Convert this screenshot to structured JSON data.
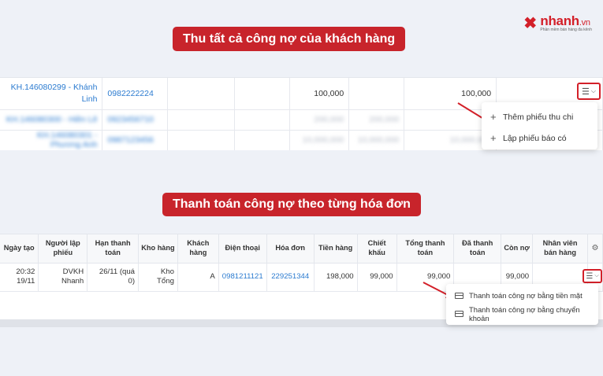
{
  "brand": {
    "name": "nhanh",
    "suffix": ".vn",
    "tagline": "Phần mềm bán hàng đa kênh"
  },
  "colors": {
    "accent": "#c8242b",
    "link": "#2b7bd0"
  },
  "banners": {
    "top": "Thu tất cả công nợ của khách hàng",
    "bottom": "Thanh toán công nợ theo từng hóa đơn"
  },
  "section1": {
    "row": {
      "customer": "KH.146080299 - Khánh Linh",
      "phone": "0982222224",
      "amount_a": "100,000",
      "amount_b": "100,000"
    },
    "blurred_rows": [
      {
        "customer": "KH.146080300 - Hiền Lê",
        "phone": "0923456710",
        "a": "200,000",
        "b": "200,000"
      },
      {
        "customer": "KH.146080301 - Phương Anh",
        "phone": "0987123456",
        "a": "10,000,000",
        "b": "10,000,000",
        "c": "10,000,000"
      }
    ],
    "menu": [
      "Thêm phiếu thu chi",
      "Lập phiếu báo có"
    ]
  },
  "section2": {
    "headers": [
      "Ngày tạo",
      "Người lập phiếu",
      "Hạn thanh toán",
      "Kho hàng",
      "Khách hàng",
      "Điện thoại",
      "Hóa đơn",
      "Tiền hàng",
      "Chiết khấu",
      "Tổng thanh toán",
      "Đã thanh toán",
      "Còn nợ",
      "Nhân viên bán hàng"
    ],
    "row": {
      "created": "20:32 19/11",
      "creator": "DVKH Nhanh",
      "due": "26/11 (quá 0)",
      "warehouse": "Kho Tổng",
      "customer": "A",
      "phone": "0981211121",
      "invoice": "229251344",
      "goods": "198,000",
      "discount": "99,000",
      "total": "99,000",
      "paid": "",
      "debt": "99,000",
      "staff": ""
    },
    "menu": [
      "Thanh toán công nợ bằng tiền mặt",
      "Thanh toán công nợ bằng chuyển khoản"
    ]
  }
}
